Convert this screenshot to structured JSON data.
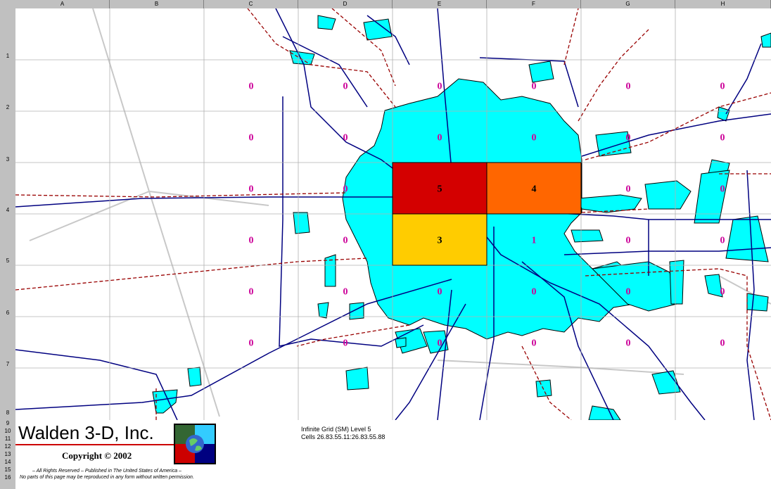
{
  "sheet": {
    "columns": [
      "A",
      "B",
      "C",
      "D",
      "E",
      "F",
      "G",
      "H"
    ],
    "rows": [
      "1",
      "2",
      "3",
      "4",
      "5",
      "6",
      "7",
      "8",
      "9",
      "10",
      "11",
      "12",
      "13",
      "14",
      "15",
      "16"
    ]
  },
  "grid": {
    "values": [
      [
        "0",
        "0",
        "0",
        "0",
        "0",
        "0"
      ],
      [
        "0",
        "0",
        "0",
        "0",
        "0",
        "0"
      ],
      [
        "0",
        "0",
        "5",
        "4",
        "0",
        "0"
      ],
      [
        "0",
        "0",
        "3",
        "1",
        "0",
        "0"
      ],
      [
        "0",
        "0",
        "0",
        "0",
        "0",
        "0"
      ],
      [
        "0",
        "0",
        "0",
        "0",
        "0",
        "0"
      ]
    ],
    "highlight": [
      {
        "row": 2,
        "col": 2,
        "color": "#d40000"
      },
      {
        "row": 2,
        "col": 3,
        "color": "#ff6600"
      },
      {
        "row": 3,
        "col": 2,
        "color": "#ffcc00"
      }
    ],
    "zero_color": "#cc0099",
    "urban_color": "#00ffff",
    "road_color": "#000080",
    "boundary_color": "#990000"
  },
  "footer": {
    "brand": "Walden 3-D, Inc.",
    "copyright": "Copyright © 2002",
    "rights": "– All Rights Reserved – Published in The United States of America –",
    "noparts": "No parts of this page may be reproduced in any form without written permission.",
    "grid_title": "Infinite Grid (SM) Level 5",
    "cells": "Cells 26.83.55.11:26.83.55.88"
  }
}
